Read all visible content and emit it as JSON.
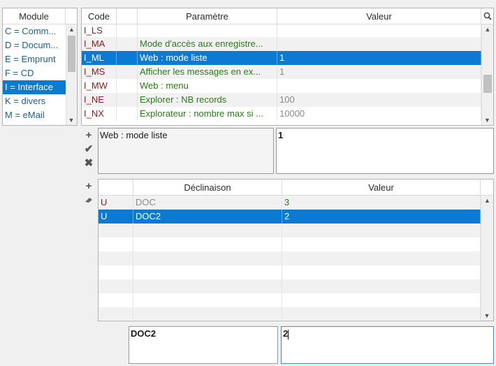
{
  "module_list": {
    "header": "Module",
    "items": [
      {
        "label": "C = Comm..."
      },
      {
        "label": "D = Docum..."
      },
      {
        "label": "E = Emprunt"
      },
      {
        "label": "F = CD"
      },
      {
        "label": "I = Interface"
      },
      {
        "label": "K = divers"
      },
      {
        "label": "M = eMail"
      }
    ],
    "selected_index": 4
  },
  "param_table": {
    "headers": {
      "code": "Code",
      "param": "Paramètre",
      "value": "Valeur"
    },
    "rows": [
      {
        "code": "I_LS",
        "param": "",
        "value": ""
      },
      {
        "code": "I_MA",
        "param": "Mode d'accès aux enregistre...",
        "value": ""
      },
      {
        "code": "I_ML",
        "param": "Web : mode liste",
        "value": "1"
      },
      {
        "code": "I_MS",
        "param": "Afficher les messages en ex...",
        "value": "1"
      },
      {
        "code": "I_MW",
        "param": "Web : menu",
        "value": ""
      },
      {
        "code": "I_NE",
        "param": "Explorer : NB records",
        "value": "100"
      },
      {
        "code": "I_NX",
        "param": "Explorateur : nombre max si ...",
        "value": "10000"
      }
    ],
    "selected_index": 2
  },
  "detail": {
    "param_text": "Web : mode liste",
    "value_text": "1"
  },
  "decl_table": {
    "headers": {
      "declinaison": "Déclinaison",
      "value": "Valeur"
    },
    "rows": [
      {
        "code": "U",
        "declinaison": "DOC",
        "value": "3"
      },
      {
        "code": "U",
        "declinaison": "DOC2",
        "value": "2"
      }
    ],
    "selected_index": 1
  },
  "bottom_edit": {
    "declinaison": "DOC2",
    "value": "2"
  },
  "colors": {
    "selection": "#0b7ad3",
    "code_red": "#8b1a1a",
    "param_green": "#2a7a1a"
  }
}
